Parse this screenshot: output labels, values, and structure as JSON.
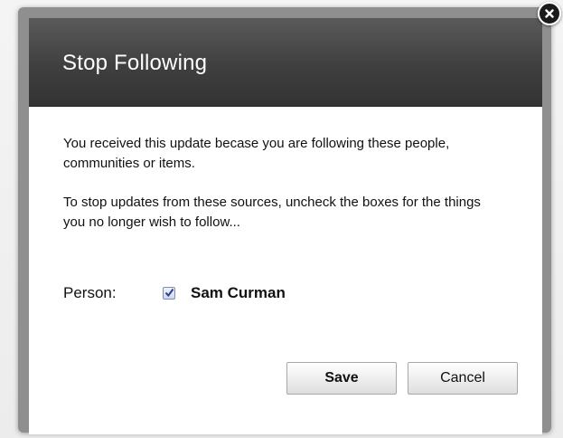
{
  "dialog": {
    "title": "Stop Following",
    "paragraph1": "You received this update becase you are following these people, communities or items.",
    "paragraph2": "To stop updates from these sources, uncheck the boxes for the things you no longer wish to follow...",
    "follow_item": {
      "label": "Person:",
      "name": "Sam Curman",
      "checked": true
    },
    "buttons": {
      "save_label": "Save",
      "cancel_label": "Cancel"
    }
  },
  "icons": {
    "close": "close-icon",
    "checkmark": "checkmark-icon"
  },
  "colors": {
    "header": "#3f3f3f",
    "checkbox_check": "#2b3f8c"
  }
}
